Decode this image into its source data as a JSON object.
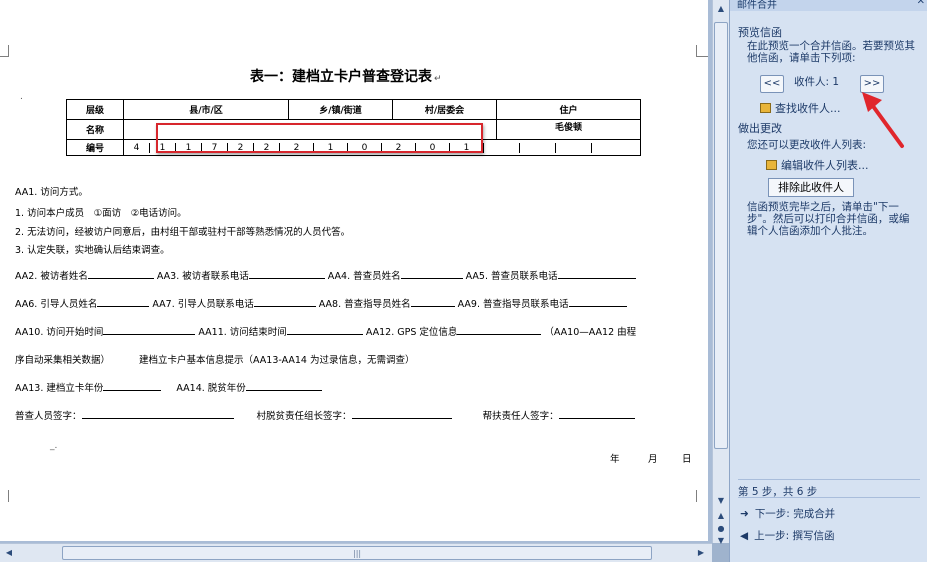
{
  "document": {
    "title": "表一：建档立卡户普查登记表",
    "table": {
      "row1": [
        "层级",
        "县/市/区",
        "乡/镇/街道",
        "村/居委会",
        "住户"
      ],
      "row2_label": "名称",
      "row2_right": "毛俊顿",
      "row3_label": "编号",
      "codes": [
        "4",
        "1",
        "1",
        "7",
        "2",
        "2",
        "2",
        "1",
        "0",
        "2",
        "0",
        "1"
      ]
    },
    "aa1": "AA1. 访问方式。",
    "opt1": "1. 访问本户成员　①面访　②电话访问。",
    "opt2": "2. 无法访问，经被访户同意后，由村组干部或驻村干部等熟悉情况的人员代答。",
    "opt3": "3. 认定失联，实地确认后结束调查。",
    "aa2": "AA2. 被访者姓名",
    "aa3": "AA3. 被访者联系电话",
    "aa4": "AA4. 普查员姓名",
    "aa5": "AA5. 普查员联系电话",
    "aa6": "AA6. 引导人员姓名",
    "aa7": "AA7. 引导人员联系电话",
    "aa8": "AA8. 普查指导员姓名",
    "aa9": "AA9. 普查指导员联系电话",
    "aa10": "AA10. 访问开始时间",
    "aa11": "AA11. 访问结束时间",
    "aa12": "AA12. GPS 定位信息",
    "aa12_note": "（AA10—AA12 由程",
    "aa12_note2": "序自动采集相关数据）",
    "hint": "建档立卡户基本信息提示（AA13-AA14 为过录信息，无需调查）",
    "aa13": "AA13. 建档立卡年份",
    "aa14": "AA14. 脱贫年份",
    "sig1": "普查人员签字：",
    "sig2": "村脱贫责任组长签字：",
    "sig3": "帮扶责任人签字：",
    "year": "年",
    "month": "月",
    "day": "日"
  },
  "pane": {
    "title": "邮件合并",
    "close": "✕",
    "preview_heading": "预览信函",
    "preview_text": "在此预览一个合并信函。若要预览其他信函，请单击下列项:",
    "prev_btn": "<<",
    "next_btn": ">>",
    "recipient_label": "收件人: 1",
    "find_link": "查找收件人...",
    "changes_heading": "做出更改",
    "changes_text": "您还可以更改收件人列表:",
    "edit_link": "编辑收件人列表...",
    "exclude_btn": "排除此收件人",
    "finish_text": "信函预览完毕之后，请单击\"下一步\"。然后可以打印合并信函，或编辑个人信函添加个人批注。",
    "step": "第 5 步，共 6 步",
    "next_step": "下一步: 完成合并",
    "prev_step": "上一步: 撰写信函"
  },
  "colors": {
    "highlight": "#d7262c",
    "pane_bg": "#d6e2f2",
    "pane_text": "#1d3a68"
  }
}
